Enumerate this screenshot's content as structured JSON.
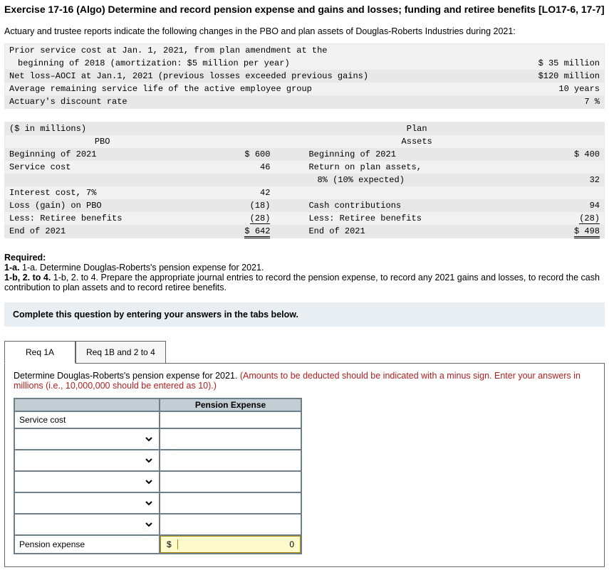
{
  "title": "Exercise 17-16 (Algo) Determine and record pension expense and gains and losses; funding and retiree benefits [LO17-6, 17-7]",
  "intro": "Actuary and trustee reports indicate the following changes in the PBO and plan assets of Douglas-Roberts Industries during 2021:",
  "given": {
    "row1_label": "Prior service cost at Jan. 1, 2021, from plan amendment at the",
    "row1b_label": "  beginning of 2018 (amortization: $5 million per year)",
    "row1_val": "$ 35 million",
    "row2_label": "Net loss–AOCI at Jan.1, 2021 (previous losses exceeded previous gains)",
    "row2_val": "$120 million",
    "row3_label": "Average remaining service life of the active employee group",
    "row3_val": "10 years",
    "row4_label": "Actuary's discount rate",
    "row4_val": "7 %"
  },
  "roll": {
    "header_left": "($ in millions)",
    "header_pbo": "PBO",
    "header_plan": "Plan",
    "header_assets": "Assets",
    "l_begin": "Beginning of 2021",
    "pbo_begin": "$ 600",
    "r_begin": "Beginning of 2021",
    "pa_begin": "$ 400",
    "l_sc": "Service cost",
    "pbo_sc": "46",
    "r_return": "Return on plan assets,",
    "r_return2": "  8% (10% expected)",
    "pa_return": "32",
    "l_int": "Interest cost, 7%",
    "pbo_int": "42",
    "l_loss": "Loss (gain) on PBO",
    "pbo_loss": "(18)",
    "r_cash": "Cash contributions",
    "pa_cash": "94",
    "l_ret": "Less: Retiree benefits",
    "pbo_ret": "(28)",
    "r_ret": "Less: Retiree benefits",
    "pa_ret": "(28)",
    "l_end": "End of 2021",
    "pbo_end": "$ 642",
    "r_end": "End of 2021",
    "pa_end": "$ 498"
  },
  "required": {
    "heading": "Required:",
    "line1": "1-a. Determine Douglas-Roberts's pension expense for 2021.",
    "line2": "1-b, 2. to 4. Prepare the appropriate journal entries to record the pension expense, to record any 2021 gains and losses, to record the cash contribution to plan assets and to record retiree benefits."
  },
  "tab_instruction": "Complete this question by entering your answers in the tabs below.",
  "tabs": {
    "a": "Req 1A",
    "b": "Req 1B and 2 to 4"
  },
  "panel": {
    "prompt_plain": "Determine Douglas-Roberts's pension expense for 2021. ",
    "prompt_red": "(Amounts to be deducted should be indicated with a minus sign. Enter your answers in millions (i.e., 10,000,000 should be entered as 10).)"
  },
  "table": {
    "col_header": "Pension Expense",
    "row1_label": "Service cost",
    "row_last_label": "Pension expense",
    "currency": "$",
    "total_value": "0"
  }
}
